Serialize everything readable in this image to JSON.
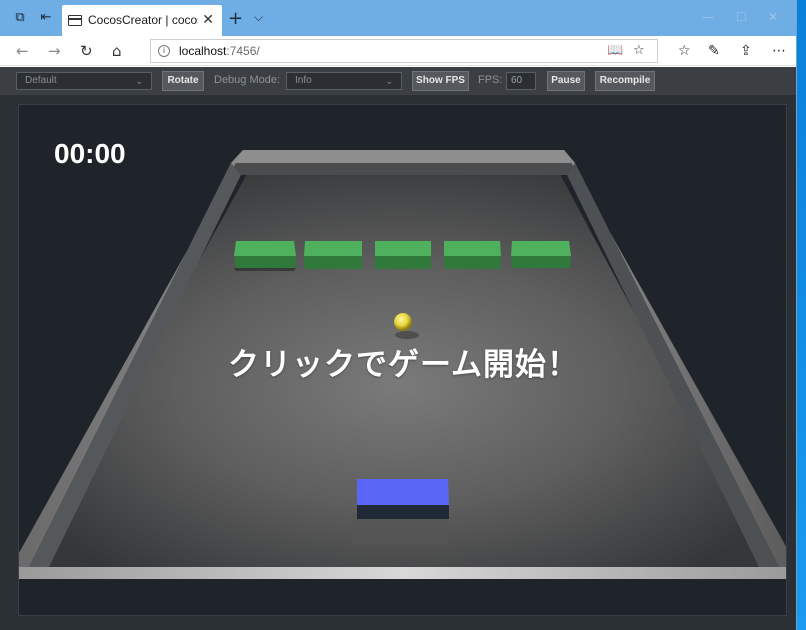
{
  "browser": {
    "tab_title": "CocosCreator | cocos-cr",
    "url_host": "localhost",
    "url_rest": ":7456/",
    "icons": {
      "tab_actions": "tab-actions-icon",
      "set_aside": "set-aside-tabs-icon",
      "page": "page-icon",
      "close": "close-icon",
      "new_tab": "plus-icon",
      "tab_list": "chevron-down-icon",
      "back": "back-arrow-icon",
      "forward": "forward-arrow-icon",
      "refresh": "refresh-icon",
      "home": "home-icon",
      "info": "info-icon",
      "reading_view": "reading-view-icon",
      "favorite": "star-icon",
      "favorites_hub": "favorites-hub-icon",
      "notes": "pen-icon",
      "share": "share-icon",
      "more": "more-icon"
    }
  },
  "cocos_toolbar": {
    "device_select": "Default",
    "rotate": "Rotate",
    "debug_mode_label": "Debug Mode:",
    "debug_mode_select": "Info",
    "show_fps": "Show FPS",
    "fps_label": "FPS:",
    "fps_value": "60",
    "pause": "Pause",
    "recompile": "Recompile"
  },
  "game": {
    "timer": "00:00",
    "start_message": "クリックでゲーム開始！",
    "colors": {
      "brick": "#3f9a4e",
      "paddle": "#5a66f5",
      "ball": "#e6d43a",
      "wall": "#7d7d7d",
      "floor": "#6b6b6b",
      "background": "#1e2429"
    },
    "bricks_count_label": "",
    "bricks": [
      {
        "id": 1
      },
      {
        "id": 2
      },
      {
        "id": 3
      },
      {
        "id": 4
      },
      {
        "id": 5
      }
    ]
  }
}
